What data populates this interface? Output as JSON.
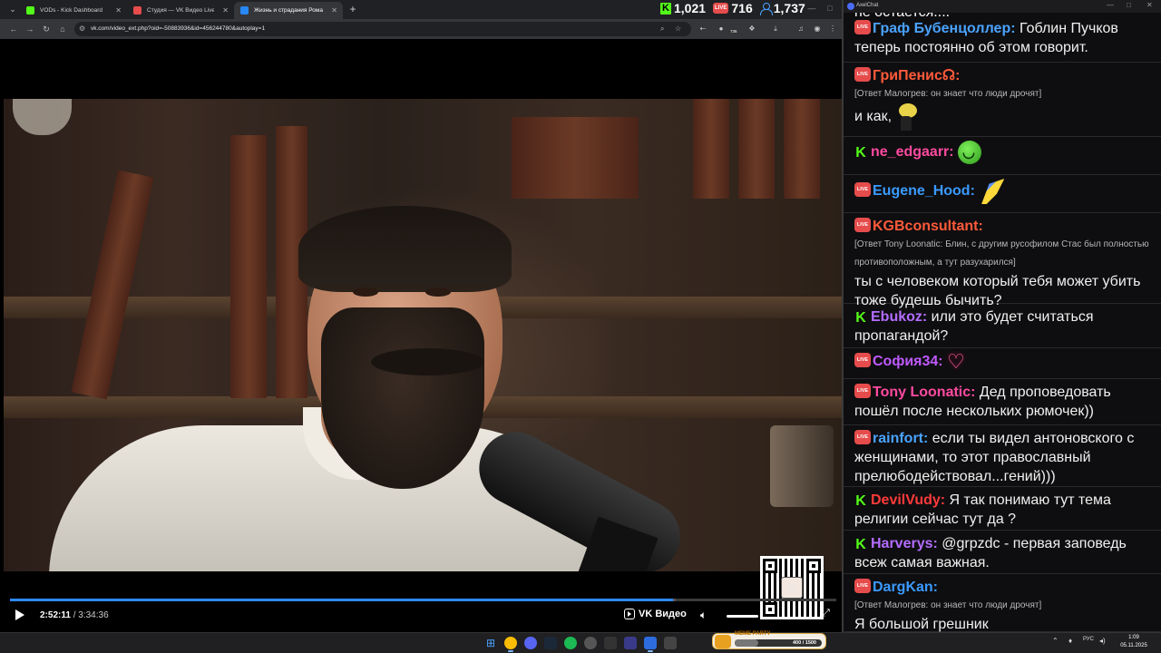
{
  "browser": {
    "tabs": [
      {
        "title": "VODs - Kick Dashboard",
        "favicon_color": "#53fc18"
      },
      {
        "title": "Студия — VK Видео Live",
        "favicon_color": "#e64c4c"
      },
      {
        "title": "Жизнь и страдания Романа А",
        "favicon_color": "#2787f5"
      }
    ],
    "new_tab": "+",
    "url": "vk.com/video_ext.php?oid=-50883936&id=456244780&autoplay=1",
    "ext_badge": "736",
    "stats": {
      "kick_viewers": "1,021",
      "vk_viewers": "716",
      "total_viewers": "1,737",
      "vk_live_label": "LIVE"
    }
  },
  "player": {
    "current_time": "2:52:11",
    "total_time": "3:34:36",
    "separator": " / ",
    "played_fraction": 0.8023,
    "buffered_fraction": 0.806,
    "brand_label": "VK Видео",
    "volume_fraction": 0.35
  },
  "chat": {
    "window_title": "AxelChat",
    "cutoff_text": "не остается....",
    "messages": [
      {
        "platform": "vk",
        "username": "Граф Бубенцоллер:",
        "color": "#4aa3ff",
        "reply": "",
        "text": "Гоблин Пучков теперь постоянно об этом говорит.",
        "inline": true,
        "emote": ""
      },
      {
        "platform": "vk",
        "username": "ГриПенис☊:",
        "color": "#ff5a3a",
        "reply": "[Ответ Малогрев: он знает что люди дрочят]",
        "text": "и как,",
        "inline": false,
        "emote": "man"
      },
      {
        "platform": "kick",
        "username": "ne_edgaarr:",
        "color": "#ff4aa0",
        "reply": "",
        "text": "",
        "inline": true,
        "emote": "smile"
      },
      {
        "platform": "vk",
        "username": "Eugene_Hood:",
        "color": "#3a9aff",
        "reply": "",
        "text": "",
        "inline": true,
        "emote": "flag"
      },
      {
        "platform": "vk",
        "username": "KGBconsultant:",
        "color": "#ff5a3a",
        "reply": "[Ответ Tony Loonatic: Блин, с другим русофилом Стас был полностью противоположным, а тут разухарился]",
        "text": "ты с человеком который тебя может убить тоже будешь бычить?",
        "inline": false,
        "emote": ""
      },
      {
        "platform": "kick",
        "username": "Ebukoz:",
        "color": "#b46cff",
        "reply": "",
        "text": "или это будет считаться пропагандой?",
        "inline": true,
        "emote": ""
      },
      {
        "platform": "vk",
        "username": "София34:",
        "color": "#c05aff",
        "reply": "",
        "text": "",
        "inline": true,
        "emote": "heart"
      },
      {
        "platform": "vk",
        "username": "Tony Loonatic:",
        "color": "#ff4aa0",
        "reply": "",
        "text": "Дед проповедовать пошёл после нескольких рюмочек))",
        "inline": true,
        "emote": ""
      },
      {
        "platform": "vk",
        "username": "rainfort:",
        "color": "#4aa3ff",
        "reply": "",
        "text": "если ты видел антоновского с женщинами, то этот православный прелюбодействовал...гений)))",
        "inline": true,
        "emote": ""
      },
      {
        "platform": "kick",
        "username": "DevilVudy:",
        "color": "#ff3a3a",
        "reply": "",
        "text": "Я так понимаю тут тема религии сейчас тут да ?",
        "inline": true,
        "emote": ""
      },
      {
        "platform": "kick",
        "username": "Harverys:",
        "color": "#b46cff",
        "reply": "",
        "text": "@grpzdc - первая заповедь всеж самая важная.",
        "inline": true,
        "emote": ""
      },
      {
        "platform": "vk",
        "username": "DargKan:",
        "color": "#3a9aff",
        "reply": "[Ответ Малогрев: он знает что люди дрочят]",
        "text": "Я большой грешник",
        "inline": false,
        "emote": ""
      }
    ]
  },
  "taskbar": {
    "widget_title": "MEME PARTY",
    "widget_progress": "400 / 1500",
    "widget_fraction": 0.267,
    "lang": "РУС",
    "time": "1:09",
    "date": "05.11.2025"
  }
}
